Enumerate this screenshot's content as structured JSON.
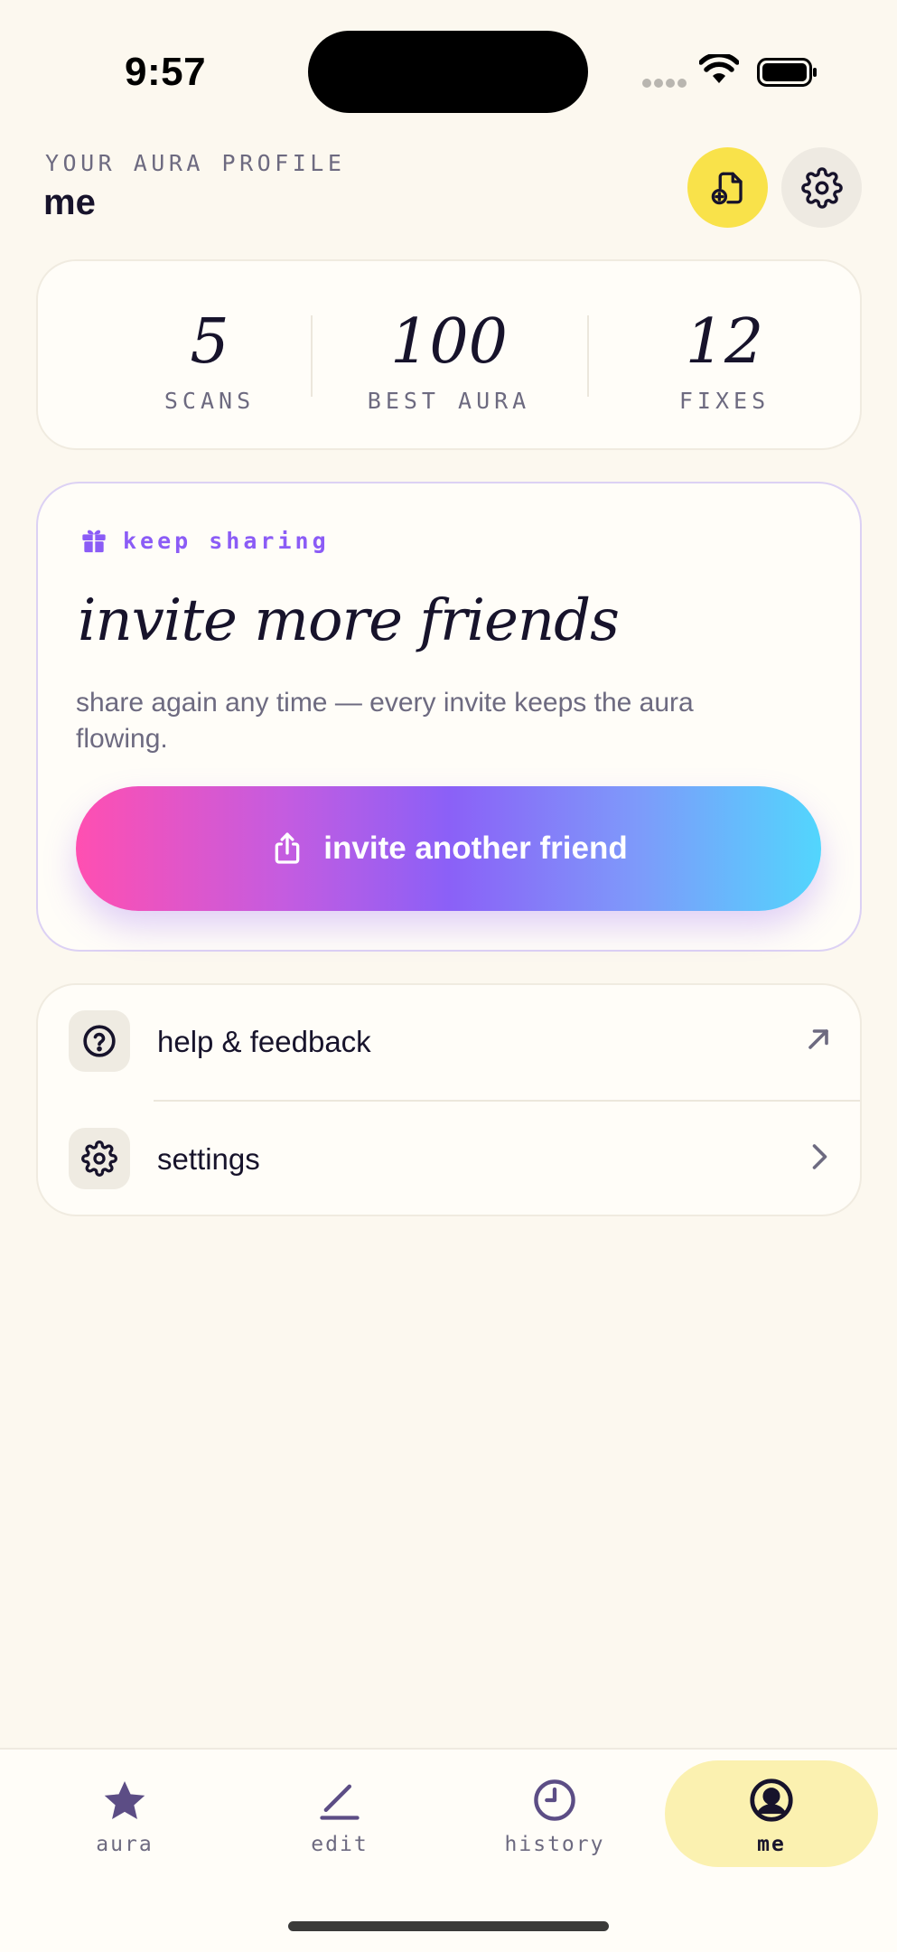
{
  "status_bar": {
    "time": "9:57"
  },
  "header": {
    "kicker": "YOUR AURA PROFILE",
    "name": "me",
    "add_icon": "file-add-icon",
    "settings_icon": "gear-icon"
  },
  "stats": [
    {
      "value": "5",
      "label": "SCANS"
    },
    {
      "value": "100",
      "label": "BEST AURA"
    },
    {
      "value": "12",
      "label": "FIXES"
    }
  ],
  "invite": {
    "kicker": "keep sharing",
    "title": "invite more friends",
    "description": "share again any time — every invite keeps the aura flowing.",
    "button_label": "invite another friend",
    "icon": "gift-icon"
  },
  "menu": [
    {
      "label": "help & feedback",
      "icon": "help-circle-icon",
      "trailing": "external-arrow-icon"
    },
    {
      "label": "settings",
      "icon": "gear-icon",
      "trailing": "chevron-right-icon"
    }
  ],
  "tabs": [
    {
      "label": "aura",
      "icon": "star-icon",
      "active": false
    },
    {
      "label": "edit",
      "icon": "pen-icon",
      "active": false
    },
    {
      "label": "history",
      "icon": "clock-icon",
      "active": false
    },
    {
      "label": "me",
      "icon": "profile-icon",
      "active": true
    }
  ],
  "colors": {
    "background": "#fcf8ef",
    "accent_yellow": "#f9e24a",
    "accent_purple": "#8b5cf6",
    "gradient_start": "#ff4fb1",
    "gradient_end": "#52d6fd"
  }
}
